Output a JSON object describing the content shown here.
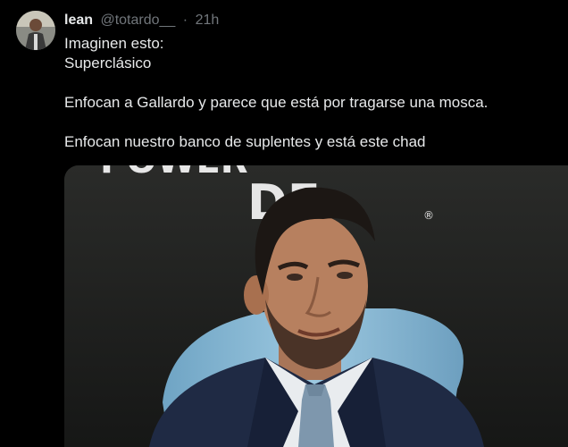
{
  "tweet": {
    "display_name": "lean",
    "handle": "@totardo__",
    "separator": "·",
    "time": "21h",
    "lines": [
      "Imaginen esto:",
      "Superclásico",
      "",
      "Enfocan a Gallardo y parece que está por tragarse una mosca.",
      "",
      "Enfocan nuestro banco de suplentes y está este chad"
    ]
  },
  "media": {
    "background_sign_text": "POWER",
    "background_sign_text_2": "DE",
    "registered_mark": "®",
    "colors": {
      "sign_text": "#e6e6e6",
      "seat": "#86b9d6",
      "suit": "#1f2a44",
      "tie": "#7e97ad",
      "shirt": "#e9ecef",
      "skin": "#b7805f",
      "hair": "#1c1714"
    }
  },
  "theme": {
    "background": "#000000",
    "text_primary": "#e7e9ea",
    "text_secondary": "#71767b"
  }
}
